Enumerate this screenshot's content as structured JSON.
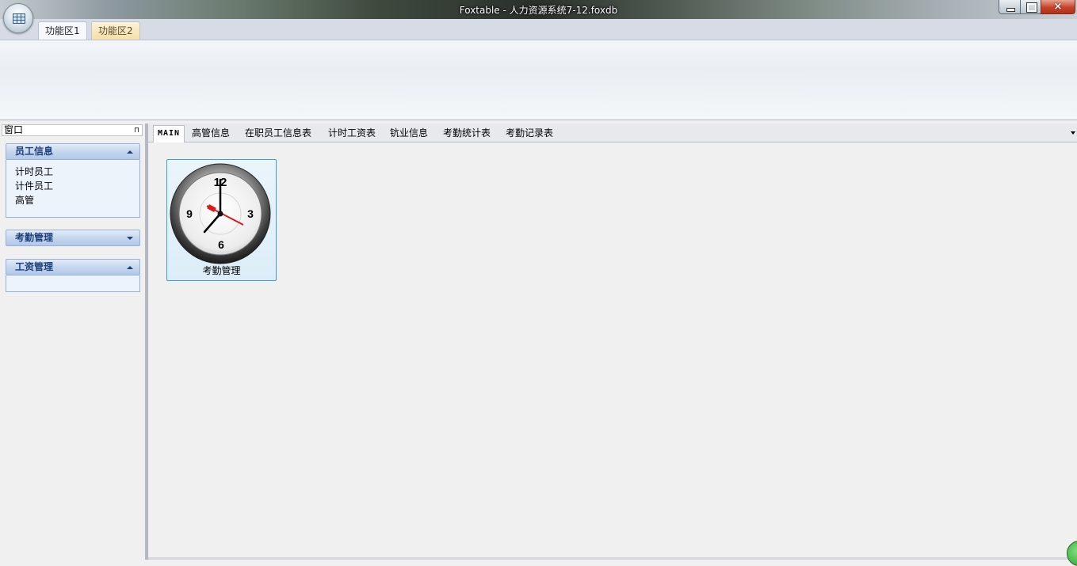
{
  "window": {
    "title": "Foxtable - 人力资源系统7-12.foxdb",
    "close_glyph": "×"
  },
  "ribbon": {
    "tabs": [
      {
        "label": "功能区1",
        "active": true
      },
      {
        "label": "功能区2",
        "active": false
      }
    ]
  },
  "left_panel": {
    "title": "窗口",
    "pin_glyph": "⊓",
    "groups": [
      {
        "label": "员工信息",
        "expanded": true,
        "items": [
          "计时员工",
          "计件员工",
          "高管"
        ]
      },
      {
        "label": "考勤管理",
        "expanded": false,
        "items": []
      },
      {
        "label": "工资管理",
        "expanded": true,
        "items": []
      }
    ]
  },
  "tabs": [
    {
      "label": "MAIN",
      "active": true
    },
    {
      "label": "高管信息",
      "active": false
    },
    {
      "label": "在职员工信息表",
      "active": false
    },
    {
      "label": "计时工资表",
      "active": false
    },
    {
      "label": "钪业信息",
      "active": false
    },
    {
      "label": "考勤统计表",
      "active": false
    },
    {
      "label": "考勤记录表",
      "active": false
    }
  ],
  "main": {
    "tile": {
      "label": "考勤管理",
      "icon": "clock-icon",
      "clock_numbers": [
        "12",
        "3",
        "6",
        "9"
      ]
    }
  },
  "colors": {
    "accent": "#3c9ed6",
    "group_header_text": "#1c3f7a",
    "clock_hand_red": "#d81b1b"
  }
}
